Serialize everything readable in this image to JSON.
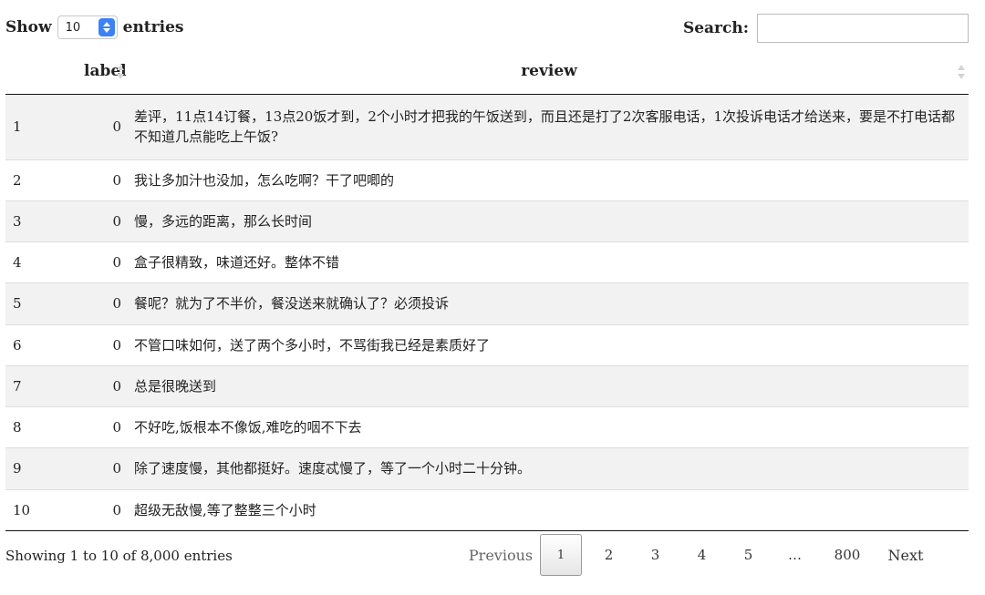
{
  "length_control": {
    "show_label": "Show",
    "selected": "10",
    "entries_label": "entries"
  },
  "search": {
    "label": "Search:",
    "value": "",
    "placeholder": ""
  },
  "table": {
    "headers": {
      "index": "",
      "label": "label",
      "review": "review"
    },
    "rows": [
      {
        "idx": "1",
        "label": "0",
        "review": "差评，11点14订餐，13点20饭才到，2个小时才把我的午饭送到，而且还是打了2次客服电话，1次投诉电话才给送来，要是不打电话都不知道几点能吃上午饭?"
      },
      {
        "idx": "2",
        "label": "0",
        "review": "我让多加汁也没加，怎么吃啊？干了吧唧的"
      },
      {
        "idx": "3",
        "label": "0",
        "review": "慢，多远的距离，那么长时间"
      },
      {
        "idx": "4",
        "label": "0",
        "review": "盒子很精致，味道还好。整体不错"
      },
      {
        "idx": "5",
        "label": "0",
        "review": "餐呢？就为了不半价，餐没送来就确认了？必须投诉"
      },
      {
        "idx": "6",
        "label": "0",
        "review": "不管口味如何，送了两个多小时，不骂街我已经是素质好了"
      },
      {
        "idx": "7",
        "label": "0",
        "review": "总是很晚送到"
      },
      {
        "idx": "8",
        "label": "0",
        "review": "不好吃,饭根本不像饭,难吃的咽不下去"
      },
      {
        "idx": "9",
        "label": "0",
        "review": "除了速度慢，其他都挺好。速度忒慢了，等了一个小时二十分钟。"
      },
      {
        "idx": "10",
        "label": "0",
        "review": "超级无敌慢,等了整整三个小时"
      }
    ]
  },
  "footer": {
    "info": "Showing 1 to 10 of 8,000 entries",
    "pagination": {
      "previous": "Previous",
      "pages": [
        "1",
        "2",
        "3",
        "4",
        "5"
      ],
      "active": "1",
      "ellipsis": "…",
      "last": "800",
      "next": "Next"
    }
  }
}
